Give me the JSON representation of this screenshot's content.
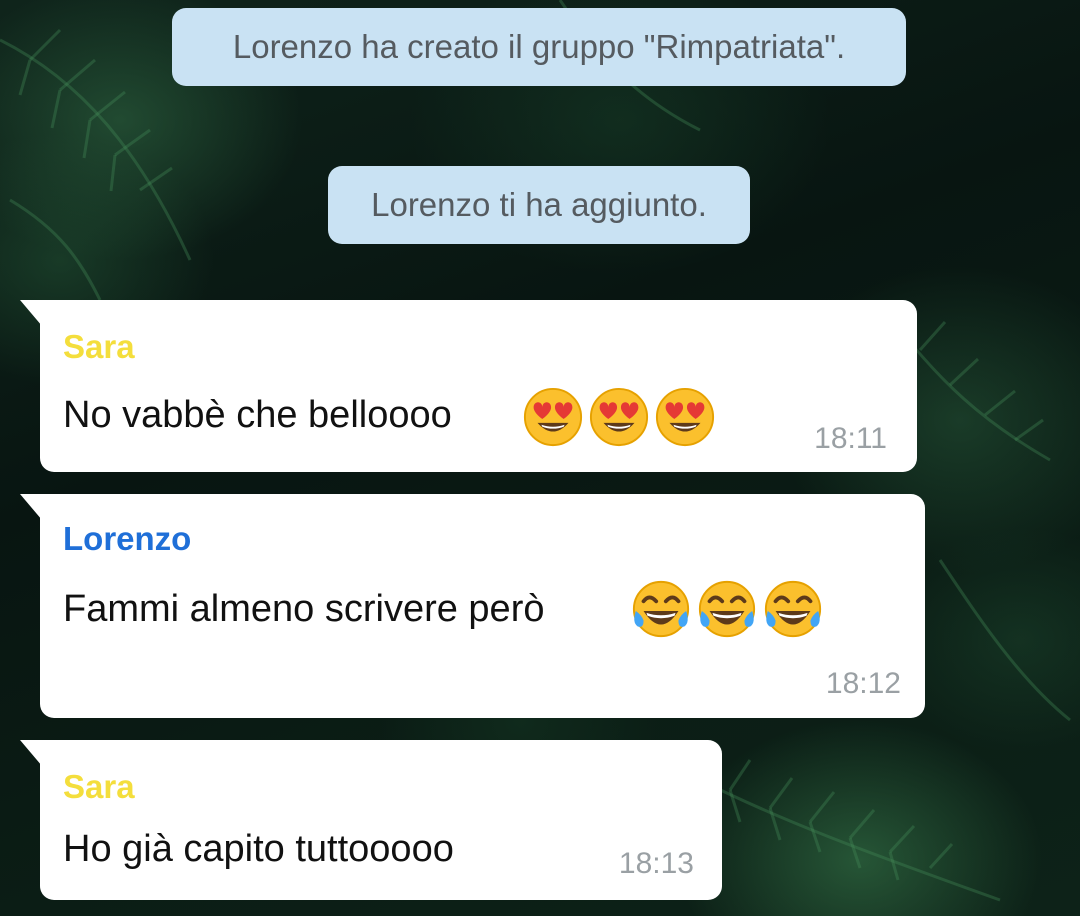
{
  "system_messages": [
    {
      "text": "Lorenzo ha creato il gruppo \"Rimpatriata\"."
    },
    {
      "text": "Lorenzo ti ha aggiunto."
    }
  ],
  "messages": [
    {
      "sender": "Sara",
      "text": "No vabbè che belloooo",
      "emojis": [
        "heart-eyes-emoji",
        "heart-eyes-emoji",
        "heart-eyes-emoji"
      ],
      "time": "18:11"
    },
    {
      "sender": "Lorenzo",
      "text": "Fammi almeno scrivere però",
      "emojis": [
        "tears-of-joy-emoji",
        "tears-of-joy-emoji",
        "tears-of-joy-emoji"
      ],
      "time": "18:12"
    },
    {
      "sender": "Sara",
      "text": "Ho già capito tuttooooo",
      "emojis": [],
      "time": "18:13"
    }
  ],
  "colors": {
    "system_bubble": "#c9e2f3",
    "incoming_bubble": "#ffffff",
    "sender_sara": "#f4de3c",
    "sender_lorenzo": "#1f6fd8",
    "timestamp": "#9aa0a4"
  }
}
